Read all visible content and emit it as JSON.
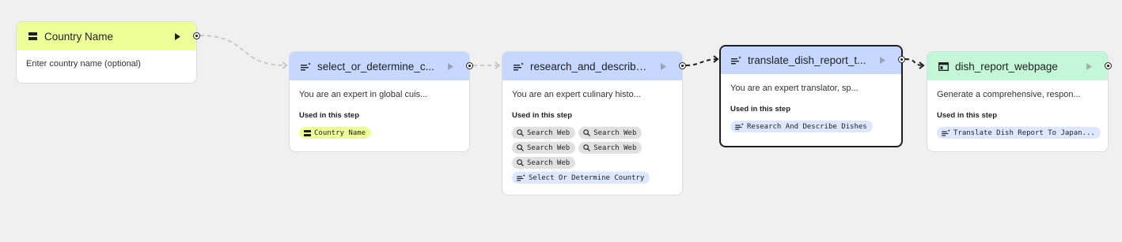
{
  "nodes": {
    "country_name": {
      "title": "Country Name",
      "prompt": "Enter country name (optional)"
    },
    "select_country": {
      "title": "select_or_determine_c...",
      "prompt": "You are an expert in global cuis...",
      "used_label": "Used in this step",
      "chips": [
        "Country Name"
      ]
    },
    "research": {
      "title": "research_and_describe...",
      "prompt": "You are an expert culinary histo...",
      "used_label": "Used in this step",
      "tools": [
        "Search Web",
        "Search Web",
        "Search Web",
        "Search Web",
        "Search Web"
      ],
      "step_chip": "Select Or Determine Country"
    },
    "translate": {
      "title": "translate_dish_report_t...",
      "prompt": "You are an expert translator, sp...",
      "used_label": "Used in this step",
      "step_chip": "Research And Describe Dishes"
    },
    "webpage": {
      "title": "dish_report_webpage",
      "prompt": "Generate a comprehensive, respon...",
      "used_label": "Used in this step",
      "step_chip": "Translate Dish Report To Japan..."
    }
  },
  "icons": {
    "input": "input-node-icon",
    "generate": "generate-text-icon",
    "output": "webpage-icon",
    "run": "play-icon",
    "tool": "search-icon"
  },
  "colors": {
    "canvas": "#f0f0f0",
    "input_header": "#eeff9a",
    "generate_header": "#c6d8ff",
    "output_header": "#c3f7d8",
    "tool_chip": "#e0e0e0",
    "step_chip": "#dde7ff"
  }
}
